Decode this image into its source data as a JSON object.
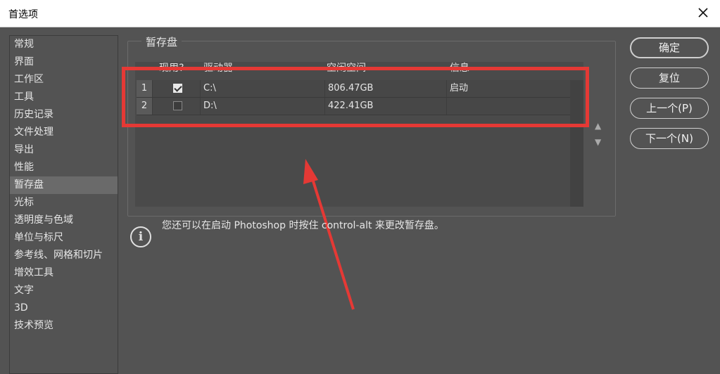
{
  "window": {
    "title": "首选项"
  },
  "sidebar": {
    "items": [
      {
        "label": "常规"
      },
      {
        "label": "界面"
      },
      {
        "label": "工作区"
      },
      {
        "label": "工具"
      },
      {
        "label": "历史记录"
      },
      {
        "label": "文件处理"
      },
      {
        "label": "导出"
      },
      {
        "label": "性能"
      },
      {
        "label": "暂存盘",
        "active": true
      },
      {
        "label": "光标"
      },
      {
        "label": "透明度与色域"
      },
      {
        "label": "单位与标尺"
      },
      {
        "label": "参考线、网格和切片"
      },
      {
        "label": "增效工具"
      },
      {
        "label": "文字"
      },
      {
        "label": "3D"
      },
      {
        "label": "技术预览"
      }
    ]
  },
  "scratch": {
    "group_title": "暂存盘",
    "columns": {
      "active": "现用?",
      "drive": "驱动器",
      "space": "空闲空间",
      "info": "信息"
    },
    "rows": [
      {
        "index": "1",
        "checked": true,
        "drive": "C:\\",
        "space": "806.47GB",
        "info": "启动"
      },
      {
        "index": "2",
        "checked": false,
        "drive": "D:\\",
        "space": "422.41GB",
        "info": ""
      }
    ],
    "arrows": {
      "up": "▲",
      "down": "▼"
    }
  },
  "info": {
    "text": "您还可以在启动 Photoshop 时按住 control-alt 来更改暂存盘。"
  },
  "buttons": {
    "ok": "确定",
    "reset": "复位",
    "prev": "上一个(P)",
    "next": "下一个(N)"
  },
  "colors": {
    "panel": "#535353",
    "highlight": "#e53935"
  }
}
